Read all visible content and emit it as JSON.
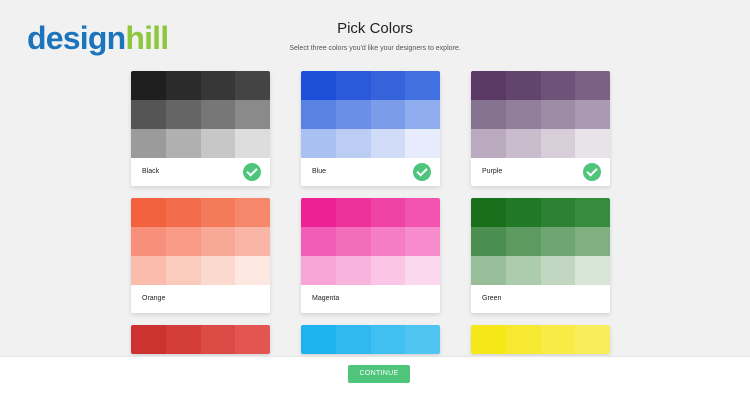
{
  "logo": {
    "part1": "design",
    "part2": "hill"
  },
  "header": {
    "title": "Pick Colors",
    "subtitle": "Select three colors you'd like your designers to explore."
  },
  "cards": [
    {
      "label": "Black",
      "selected": true,
      "colors": [
        "#1f1f1f",
        "#2b2b2b",
        "#373737",
        "#444444",
        "#555555",
        "#656565",
        "#777777",
        "#8a8a8a",
        "#9b9b9b",
        "#b0b0b0",
        "#c7c7c7",
        "#dddddd"
      ]
    },
    {
      "label": "Blue",
      "selected": true,
      "colors": [
        "#1e4fd8",
        "#2a5ad9",
        "#3563dc",
        "#4170e0",
        "#5a82e3",
        "#6a8fe6",
        "#7b9de9",
        "#8fadee",
        "#a9c0f2",
        "#bccdf4",
        "#d0dcf7",
        "#e6ecfb"
      ]
    },
    {
      "label": "Purple",
      "selected": true,
      "colors": [
        "#5a3a64",
        "#63446c",
        "#6f5278",
        "#7b6285",
        "#857290",
        "#917f9b",
        "#9d8ca6",
        "#a99ab1",
        "#b9aac0",
        "#c8bccd",
        "#d7ced9",
        "#e8e3e9"
      ]
    },
    {
      "label": "Orange",
      "selected": false,
      "colors": [
        "#f2623f",
        "#f36d4c",
        "#f47a5a",
        "#f5876a",
        "#f6907a",
        "#f79b87",
        "#f8a896",
        "#f9b5a5",
        "#fabdad",
        "#fbcbbe",
        "#fcd9cf",
        "#fde7e1"
      ]
    },
    {
      "label": "Magenta",
      "selected": false,
      "colors": [
        "#ec2193",
        "#ee329c",
        "#f043a6",
        "#f254b0",
        "#f25eb5",
        "#f36dbd",
        "#f57dc5",
        "#f78ccd",
        "#f8a4d6",
        "#f9b4de",
        "#fbc5e6",
        "#fcd8ee"
      ]
    },
    {
      "label": "Green",
      "selected": false,
      "colors": [
        "#1a6f1c",
        "#217827",
        "#2c8232",
        "#378b3c",
        "#4b8f50",
        "#5c9a60",
        "#6ea570",
        "#80b082",
        "#98bf99",
        "#adcbad",
        "#c2d7c2",
        "#d8e6d8"
      ]
    },
    {
      "label": "",
      "selected": false,
      "colors": [
        "#cc3330",
        "#d43e3a",
        "#dc4a45",
        "#e25550"
      ]
    },
    {
      "label": "",
      "selected": false,
      "colors": [
        "#1eb3ef",
        "#2fb9f0",
        "#40bff1",
        "#51c5f2"
      ]
    },
    {
      "label": "",
      "selected": false,
      "colors": [
        "#f6e719",
        "#f7e92f",
        "#f8eb45",
        "#f9ed5b"
      ]
    }
  ],
  "footer": {
    "continue_label": "CONTINUE"
  }
}
